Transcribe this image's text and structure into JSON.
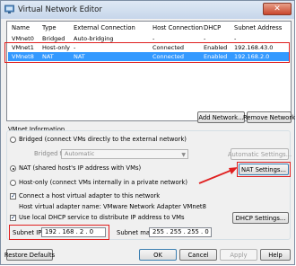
{
  "window": {
    "title": "Virtual Network Editor",
    "close_glyph": "✕"
  },
  "list": {
    "headers": [
      "Name",
      "Type",
      "External Connection",
      "Host Connection",
      "DHCP",
      "Subnet Address"
    ],
    "rows": [
      {
        "name": "VMnet0",
        "type": "Bridged",
        "ext": "Auto-bridging",
        "host": "-",
        "dhcp": "-",
        "subnet": "-",
        "selected": false
      },
      {
        "name": "VMnet1",
        "type": "Host-only",
        "ext": "-",
        "host": "Connected",
        "dhcp": "Enabled",
        "subnet": "192.168.43.0",
        "selected": false
      },
      {
        "name": "VMnet8",
        "type": "NAT",
        "ext": "NAT",
        "host": "Connected",
        "dhcp": "Enabled",
        "subnet": "192.168.2.0",
        "selected": true
      }
    ]
  },
  "buttons": {
    "add_network": "Add Network...",
    "remove_network": "Remove Network",
    "auto_settings": "Automatic Settings...",
    "nat_settings": "NAT Settings...",
    "dhcp_settings": "DHCP Settings...",
    "restore_defaults": "Restore Defaults",
    "ok": "OK",
    "cancel": "Cancel",
    "apply": "Apply",
    "help": "Help"
  },
  "vmnet_info": {
    "title": "VMnet Information",
    "bridged_label": "Bridged (connect VMs directly to the external network)",
    "bridged_to_label": "Bridged to:",
    "bridged_to_value": "Automatic",
    "nat_label": "NAT (shared host's IP address with VMs)",
    "hostonly_label": "Host-only (connect VMs internally in a private network)",
    "connect_adapter_label": "Connect a host virtual adapter to this network",
    "adapter_name_label": "Host virtual adapter name: VMware Network Adapter VMnet8",
    "use_dhcp_label": "Use local DHCP service to distribute IP address to VMs",
    "selected_mode": "nat",
    "connect_adapter_checked": true,
    "use_dhcp_checked": true
  },
  "subnet": {
    "ip_label": "Subnet IP:",
    "ip_value": "192 . 168 . 2 . 0",
    "mask_label": "Subnet mask:",
    "mask_value": "255 . 255 . 255 . 0"
  },
  "colors": {
    "selection": "#3399ff",
    "annotation": "#e02020"
  }
}
